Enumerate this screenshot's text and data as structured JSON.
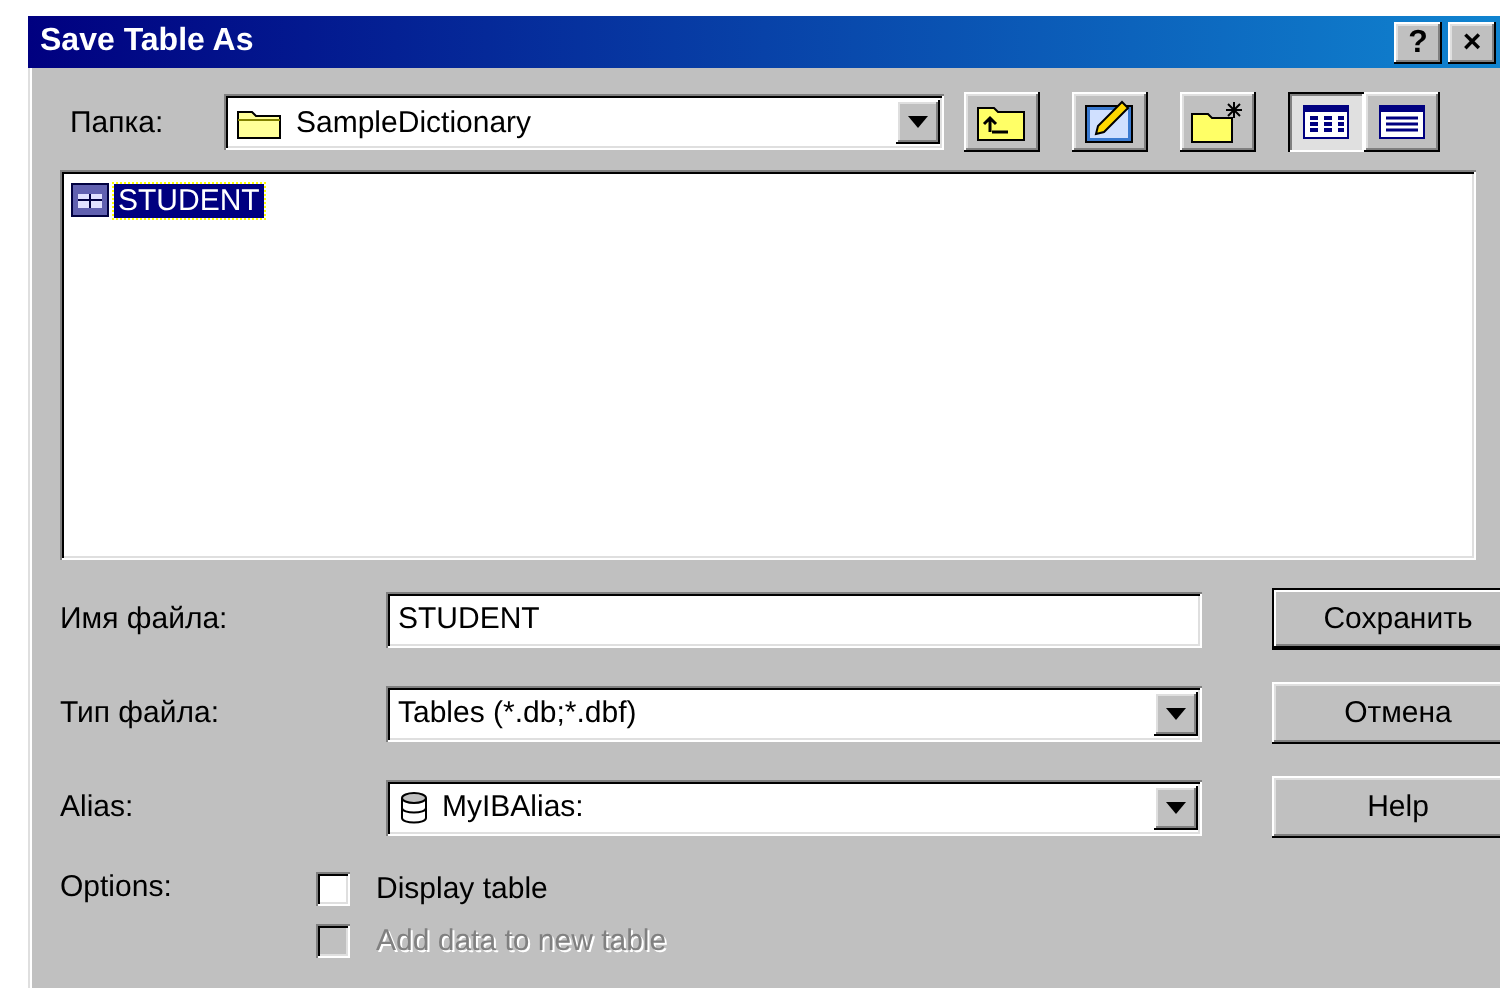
{
  "window": {
    "title": "Save Table As",
    "title_buttons": [
      "?",
      "×"
    ]
  },
  "folder": {
    "label": "Папка:",
    "value": "SampleDictionary"
  },
  "view_buttons": [
    {
      "kind": "list",
      "selected": true
    },
    {
      "kind": "details",
      "selected": false
    }
  ],
  "files": [
    {
      "name": "STUDENT",
      "selected": true
    }
  ],
  "file_name": {
    "label": "Имя файла:",
    "value": "STUDENT"
  },
  "file_type": {
    "label": "Тип файла:",
    "value": "Tables (*.db;*.dbf)"
  },
  "alias": {
    "label": "Alias:",
    "value": "MyIBAlias:"
  },
  "buttons": [
    {
      "label": "Сохранить",
      "default": true
    },
    {
      "label": "Отмена",
      "default": false
    },
    {
      "label": "Help",
      "default": false
    }
  ],
  "options": {
    "label": "Options:",
    "items": [
      {
        "label": "Display table",
        "checked": false,
        "disabled": false
      },
      {
        "label": "Add data to new table",
        "checked": false,
        "disabled": true
      }
    ]
  }
}
